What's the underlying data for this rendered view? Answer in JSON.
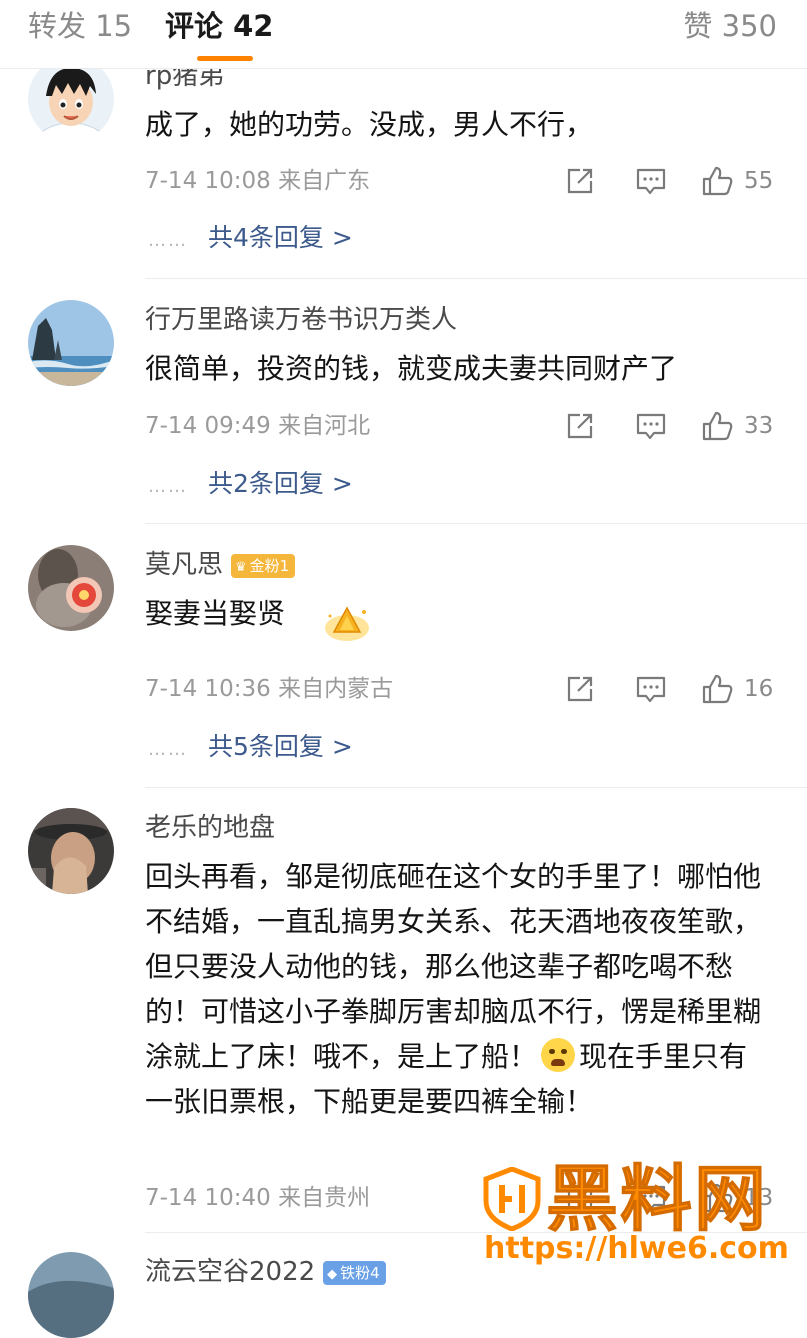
{
  "tabs": {
    "reposts": "转发 15",
    "comments": "评论 42",
    "likes": "赞 350"
  },
  "comments": [
    {
      "username": "rp猪弟",
      "text": "成了，她的功劳。没成，男人不行，",
      "meta": "7-14 10:08  来自广东",
      "likes": "55",
      "replies": "共4条回复 >"
    },
    {
      "username": "行万里路读万卷书识万类人",
      "text": "很简单，投资的钱，就变成夫妻共同财产了",
      "meta": "7-14 09:49  来自河北",
      "likes": "33",
      "replies": "共2条回复 >"
    },
    {
      "username": "莫凡思",
      "badge": "金粉1",
      "text": "娶妻当娶贤",
      "meta": "7-14 10:36  来自内蒙古",
      "likes": "16",
      "replies": "共5条回复 >"
    },
    {
      "username": "老乐的地盘",
      "text_before_emoji": "回头再看，邹是彻底砸在这个女的手里了！哪怕他不结婚，一直乱搞男女关系、花天酒地夜夜笙歌，但只要没人动他的钱，那么他这辈子都吃喝不愁的！可惜这小子拳脚厉害却脑瓜不行，愣是稀里糊涂就上了床！哦不，是上了船！",
      "text_after_emoji": "现在手里只有一张旧票根，下船更是要四裤全输！",
      "meta": "7-14 10:40  来自贵州",
      "likes": "13"
    },
    {
      "username": "流云空谷2022",
      "badge": "铁粉4"
    }
  ],
  "reply_dots": "……",
  "icons": [
    "share-icon",
    "comment-icon",
    "thumbs-up-icon",
    "crying-face-emoji",
    "gold-crown-sticker"
  ],
  "watermark": {
    "text": "黑料网",
    "url": "https://hlwe6.com"
  },
  "colors": {
    "accent": "#ff8200",
    "link": "#3d5a8c",
    "meta": "#9a9a9a",
    "badge_gold": "#f5b73b",
    "badge_iron": "#6aa0e6",
    "watermark": "#ff8a00"
  }
}
